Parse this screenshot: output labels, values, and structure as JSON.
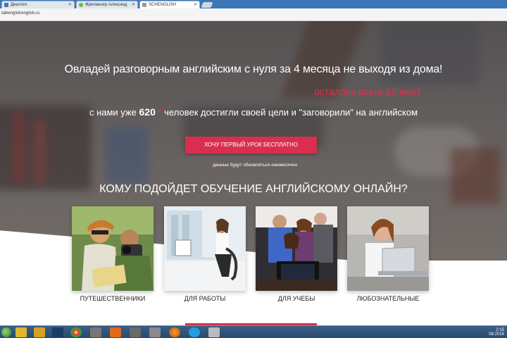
{
  "browser": {
    "tabs": [
      {
        "label": "Диалоги",
        "active": false
      },
      {
        "label": "Фрилансер Александ",
        "active": false
      },
      {
        "label": "SCHENGLISH",
        "active": true
      }
    ],
    "address": "talkenglishenglish.ru"
  },
  "hero": {
    "headline": "Овладей разговорным английским с нуля за 4 месяца не выходя из дома!",
    "remaining": "осталось всего 12 мест",
    "counter_prefix": "с нами уже",
    "counter_value": "620",
    "counter_star": "*",
    "counter_suffix": "человек достигли своей цели и \"заговорили\" на английском",
    "cta_label": "ХОЧУ ПЕРВЫЙ УРОК БЕСПЛАТНО",
    "note_star": "*",
    "note_text": "данные будут обновляться ежемесячно"
  },
  "section": {
    "title": "КОМУ ПОДОЙДЕТ ОБУЧЕНИЕ АНГЛИЙСКОМУ ОНЛАЙН?",
    "cards": [
      {
        "label": "ПУТЕШЕСТВЕННИКИ"
      },
      {
        "label": "ДЛЯ РАБОТЫ"
      },
      {
        "label": "ДЛЯ УЧЕБЫ"
      },
      {
        "label": "ЛЮБОЗНАТЕЛЬНЫЕ"
      }
    ]
  },
  "taskbar": {
    "clock_line1": "2:15",
    "clock_line2": "08.2016"
  },
  "colors": {
    "accent": "#d92f4e",
    "taskbar": "#2a4a6e"
  }
}
